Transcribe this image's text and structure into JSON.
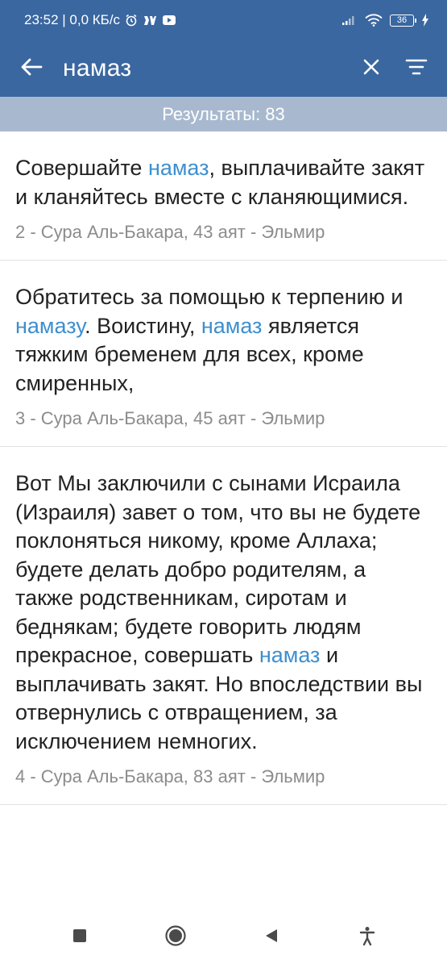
{
  "status_bar": {
    "time_speed": "23:52 | 0,0 КБ/с",
    "battery": "36",
    "icons": [
      "alarm-icon",
      "signal-app-icon",
      "media-app-icon",
      "cell-signal-icon",
      "wifi-icon",
      "battery-icon",
      "charging-icon"
    ]
  },
  "app_bar": {
    "query": "намаз",
    "icons": [
      "back-arrow-icon",
      "close-icon",
      "filter-icon"
    ]
  },
  "results": {
    "label": "Результаты: 83"
  },
  "items": [
    {
      "segments": [
        {
          "text": "Совершайте ",
          "hl": false
        },
        {
          "text": "намаз",
          "hl": true
        },
        {
          "text": ", выплачивайте закят и кланяйтесь вместе с кланяющимися.",
          "hl": false
        }
      ],
      "ref": "2 - Сура Аль-Бакара, 43 аят - Эльмир"
    },
    {
      "segments": [
        {
          "text": "Обратитесь за помощью к терпению и ",
          "hl": false
        },
        {
          "text": "намазу",
          "hl": true
        },
        {
          "text": ". Воистину, ",
          "hl": false
        },
        {
          "text": "намаз",
          "hl": true
        },
        {
          "text": " является тяжким бременем для всех, кроме смиренных,",
          "hl": false
        }
      ],
      "ref": "3 - Сура Аль-Бакара, 45 аят - Эльмир"
    },
    {
      "segments": [
        {
          "text": "Вот Мы заключили с сынами Исраила (Израиля) завет о том, что вы не будете поклоняться никому, кроме Аллаха; будете делать добро родителям, а также родственникам, сиротам и беднякам; будете говорить людям прекрасное, совершать ",
          "hl": false
        },
        {
          "text": "намаз",
          "hl": true
        },
        {
          "text": " и выплачивать закят. Но впоследствии вы отвернулись с отвращением, за исключением немногих.",
          "hl": false
        }
      ],
      "ref": "4 - Сура Аль-Бакара, 83 аят - Эльмир"
    }
  ],
  "nav_bar": {
    "icons": [
      "recents-square-icon",
      "home-circle-icon",
      "back-triangle-icon",
      "accessibility-icon"
    ]
  },
  "colors": {
    "primary": "#3a67a0",
    "results_bar": "#a8b9cf",
    "highlight": "#3d8fd0",
    "text": "#222222",
    "reference": "#8c8c8c"
  }
}
